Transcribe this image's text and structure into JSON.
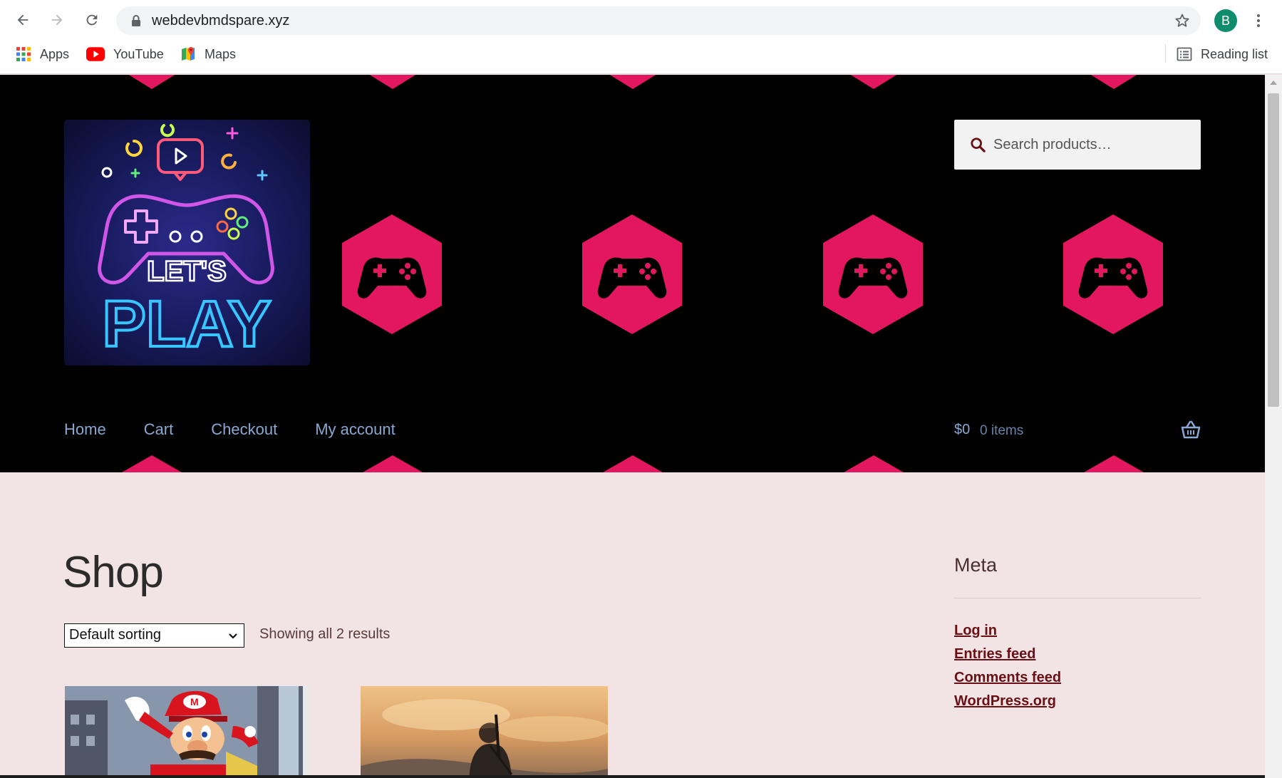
{
  "browser": {
    "url": "webdevbmdspare.xyz",
    "profile_initial": "B",
    "bookmarks": [
      {
        "label": "Apps",
        "icon": "apps-grid-icon"
      },
      {
        "label": "YouTube",
        "icon": "youtube-icon"
      },
      {
        "label": "Maps",
        "icon": "maps-icon"
      }
    ],
    "reading_list": "Reading list"
  },
  "header": {
    "logo_alt": "LET'S PLAY",
    "search_placeholder": "Search products…",
    "nav": [
      "Home",
      "Cart",
      "Checkout",
      "My account"
    ],
    "cart_amount": "$0",
    "cart_count": "0 items"
  },
  "shop": {
    "title": "Shop",
    "sorting_selected": "Default sorting",
    "result_count": "Showing all 2 results",
    "products": [
      {
        "image": "super-mario-odyssey-cover"
      },
      {
        "image": "zelda-breath-of-the-wild-cover"
      }
    ]
  },
  "sidebar": {
    "title": "Meta",
    "links": [
      "Log in",
      "Entries feed",
      "Comments feed",
      "WordPress.org"
    ]
  },
  "colors": {
    "header_bg": "#000000",
    "hex_pink": "#e3175f",
    "nav_link": "#89a8d2",
    "page_bg": "#f2e4e5",
    "meta_link": "#6a0f14"
  }
}
